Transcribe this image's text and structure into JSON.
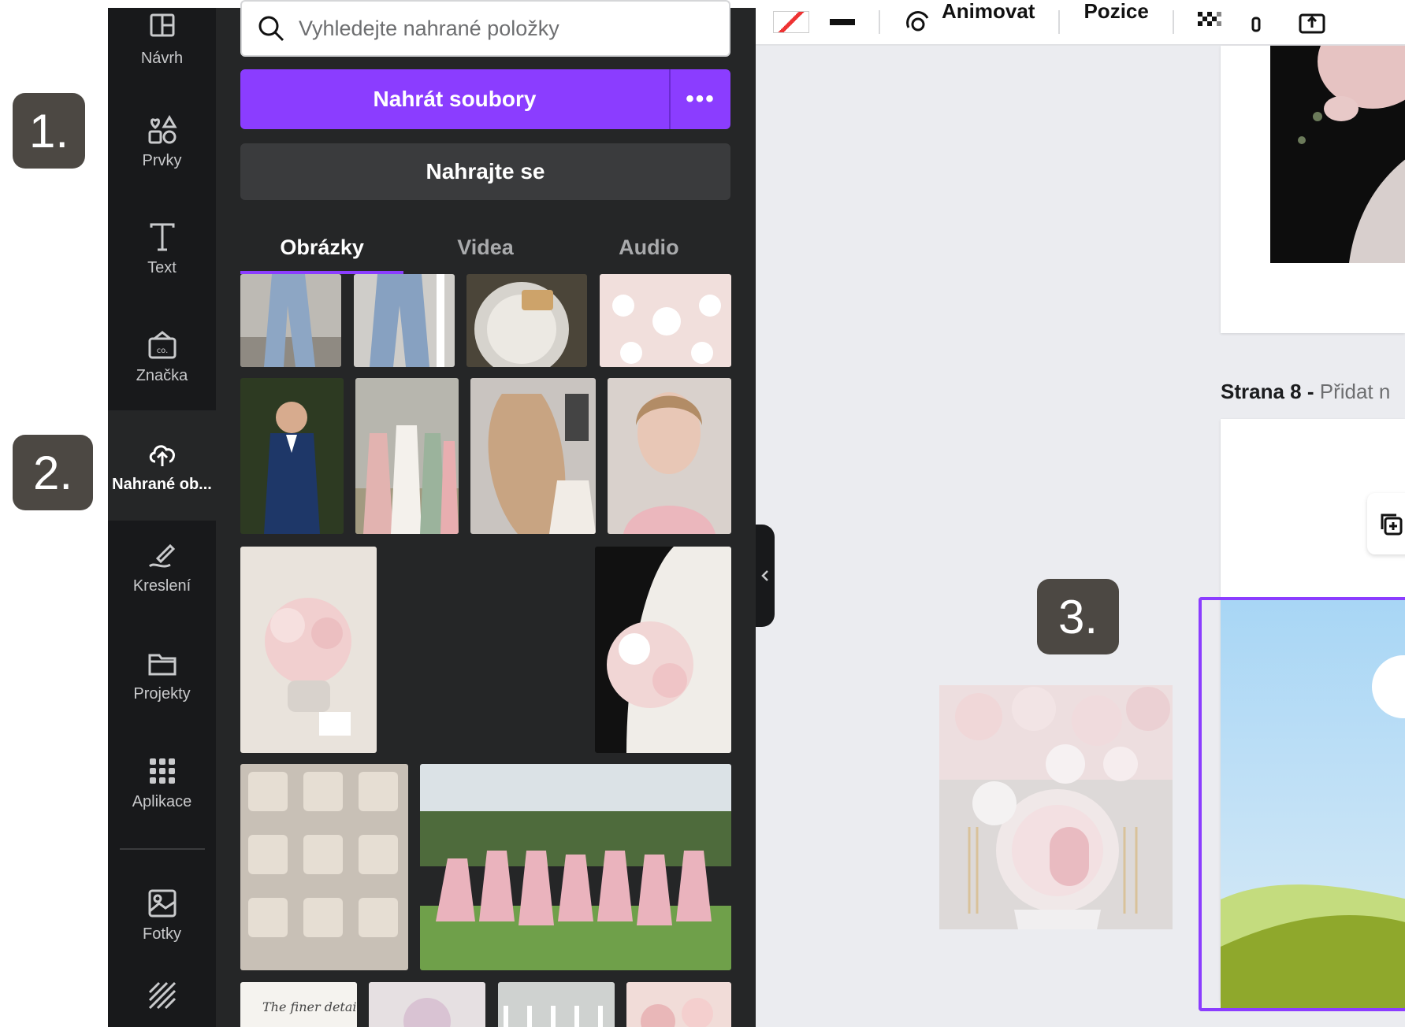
{
  "rail": {
    "items": [
      {
        "label": "Návrh",
        "icon": "design-icon"
      },
      {
        "label": "Prvky",
        "icon": "elements-icon"
      },
      {
        "label": "Text",
        "icon": "text-icon"
      },
      {
        "label": "Značka",
        "icon": "brand-icon"
      },
      {
        "label": "Nahrané ob...",
        "icon": "upload-cloud-icon",
        "active": true
      },
      {
        "label": "Kreslení",
        "icon": "draw-icon"
      },
      {
        "label": "Projekty",
        "icon": "folder-icon"
      },
      {
        "label": "Aplikace",
        "icon": "apps-icon"
      },
      {
        "label": "Fotky",
        "icon": "photos-icon"
      },
      {
        "label": "",
        "icon": "pattern-icon"
      }
    ]
  },
  "panel": {
    "search_placeholder": "Vyhledejte nahrané položky",
    "upload_label": "Nahrát soubory",
    "upload_more": "•••",
    "record_label": "Nahrajte se",
    "tabs": [
      {
        "label": "Obrázky",
        "active": true
      },
      {
        "label": "Videa"
      },
      {
        "label": "Audio"
      }
    ],
    "thumb_caption": "The finer details"
  },
  "toolbar": {
    "animate_label": "Animovat",
    "position_label": "Pozice"
  },
  "canvas": {
    "page8_label": "Strana 8 -",
    "page8_add": "Přidat n"
  },
  "badges": [
    "1.",
    "2.",
    "3."
  ],
  "colors": {
    "accent": "#8b3dff",
    "rail_bg": "#18191b",
    "panel_bg": "#252627",
    "canvas_bg": "#ebecf0",
    "badge_bg": "#4c4843"
  }
}
